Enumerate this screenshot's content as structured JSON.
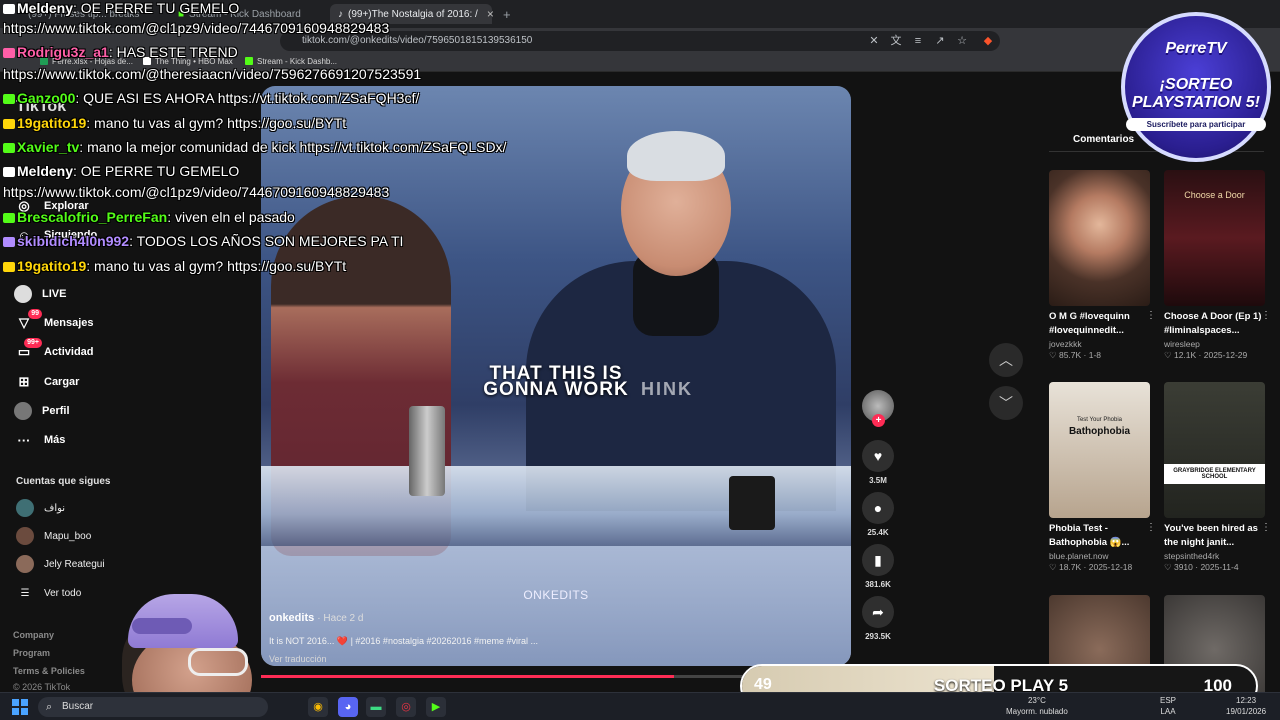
{
  "browser": {
    "tabs": [
      {
        "label": "(99+) Frases tip... breaks",
        "active": false
      },
      {
        "label": "Stream - Kick Dashboard",
        "active": false
      },
      {
        "label": "(99+)The Nostalgia of 2016: /",
        "active": true
      },
      {
        "label": "+",
        "active": false
      }
    ],
    "url": "tiktok.com/@onkedits/video/7596501815139536150",
    "bookmarks": [
      "Perre.xlsx - Hojas de...",
      "The Thing • HBO Max",
      "Stream - Kick Dashb..."
    ]
  },
  "tiktok": {
    "logo": "TikTok",
    "nav": [
      {
        "label": "Explorar",
        "icon": "compass-icon"
      },
      {
        "label": "Siguiendo",
        "icon": "following-icon"
      },
      {
        "label": "LIVE",
        "icon": "live-icon"
      },
      {
        "label": "Mensajes",
        "icon": "message-icon",
        "badge": "99"
      },
      {
        "label": "Actividad",
        "icon": "activity-icon",
        "badge": "99+"
      },
      {
        "label": "Cargar",
        "icon": "upload-icon"
      },
      {
        "label": "Perfil",
        "icon": "profile-icon"
      },
      {
        "label": "Más",
        "icon": "more-icon"
      }
    ],
    "following_title": "Cuentas que sigues",
    "following": [
      "نواف",
      "Mapu_boo",
      "Jely Reategui"
    ],
    "see_all": "Ver todo",
    "footer": [
      "Company",
      "Program",
      "Terms & Policies",
      "© 2026 TikTok"
    ],
    "video": {
      "caption_top": "THAT THIS IS",
      "caption_bottom": "GONNA WORK",
      "caption_ghost": "HINK",
      "watermark": "ONKEDITS",
      "author": "onkedits",
      "ago": "· Hace 2 d",
      "description": "It is NOT 2016... ❤️ | #2016 #nostalgia #20262016 #meme #viral ...",
      "translate": "Ver traducción",
      "progress": 0.7
    },
    "actions": [
      {
        "icon": "heart-icon",
        "count": "3.5M"
      },
      {
        "icon": "comment-icon",
        "count": "25.4K"
      },
      {
        "icon": "bookmark-icon",
        "count": "381.6K"
      },
      {
        "icon": "share-icon",
        "count": "293.5K"
      }
    ],
    "right_tabs": [
      "Comentarios"
    ],
    "cards": [
      {
        "title": "O M G #lovequinn #lovequinnedit...",
        "user": "jovezkkk",
        "stats": "♡ 85.7K · 1-8"
      },
      {
        "title": "Choose A Door (Ep 1) #liminalspaces...",
        "user": "wiresleep",
        "stats": "♡ 12.1K · 2025-12-29",
        "thumb_text": "Choose a Door"
      },
      {
        "title": "Phobia Test - Bathophobia 😱...",
        "user": "blue.planet.now",
        "stats": "♡ 18.7K · 2025-12-18",
        "thumb_text": "Bathophobia",
        "thumb_sub": "Test Your Phobia"
      },
      {
        "title": "You've been hired as the night janit...",
        "user": "stepsinthed4rk",
        "stats": "♡ 3910 · 2025-11-4",
        "thumb_text": "GRAYBRIDGE ELEMENTARY SCHOOL"
      },
      {
        "title": "",
        "user": "",
        "stats": ""
      },
      {
        "title": "",
        "user": "",
        "stats": ""
      }
    ]
  },
  "chat": [
    {
      "user": "Meldeny",
      "color": "#ffffff",
      "msg": "OE PERRE TU GEMELO"
    },
    {
      "user": "",
      "color": "#ffffff",
      "msg": "https://www.tiktok.com/@cl1pz9/video/7446709160948829483"
    },
    {
      "user": "Rodrigu3z_a1",
      "color": "#ff5fa8",
      "msg": "HAS ESTE TREND"
    },
    {
      "user": "",
      "color": "#ffffff",
      "msg": "https://www.tiktok.com/@theresiaacn/video/7596276691207523591"
    },
    {
      "user": "Ganzo00",
      "color": "#53fc18",
      "msg": "QUE ASI ES AHORA https://vt.tiktok.com/ZSaFQH3cf/"
    },
    {
      "user": "19gatito19",
      "color": "#ffd60a",
      "msg": "mano tu vas al gym? https://goo.su/BYTt"
    },
    {
      "user": "Xavier_tv",
      "color": "#53fc18",
      "msg": "mano la mejor comunidad de kick https://vt.tiktok.com/ZSaFQLSDx/"
    },
    {
      "user": "Meldeny",
      "color": "#ffffff",
      "msg": "OE PERRE TU GEMELO"
    },
    {
      "user": "",
      "color": "#ffffff",
      "msg": "https://www.tiktok.com/@cl1pz9/video/7446709160948829483"
    },
    {
      "user": "Brescalofrio_PerreFan",
      "color": "#53fc18",
      "msg": "viven eln el pasado"
    },
    {
      "user": "skibidich4l0n992",
      "color": "#b18cff",
      "msg": "TODOS LOS AÑOS SON MEJORES PA TI"
    },
    {
      "user": "19gatito19",
      "color": "#ffd60a",
      "msg": "mano tu vas al gym? https://goo.su/BYTt"
    }
  ],
  "promo": {
    "brand": "PerreTV",
    "line1": "¡SORTEO",
    "line2": "PLAYSTATION 5!",
    "cta": "Suscríbete para participar"
  },
  "goal": {
    "current": "49",
    "title": "SORTEO PLAY 5",
    "target": "100",
    "progress": 0.49
  },
  "taskbar": {
    "search": "Buscar",
    "weather": "23°C",
    "weather_sub": "Mayorm. nublado",
    "lang": "ESP",
    "lang_sub": "LAA",
    "time": "12:23",
    "date": "19/01/2026"
  },
  "colors": {
    "accent": "#fe2c55",
    "kick": "#53fc18"
  }
}
